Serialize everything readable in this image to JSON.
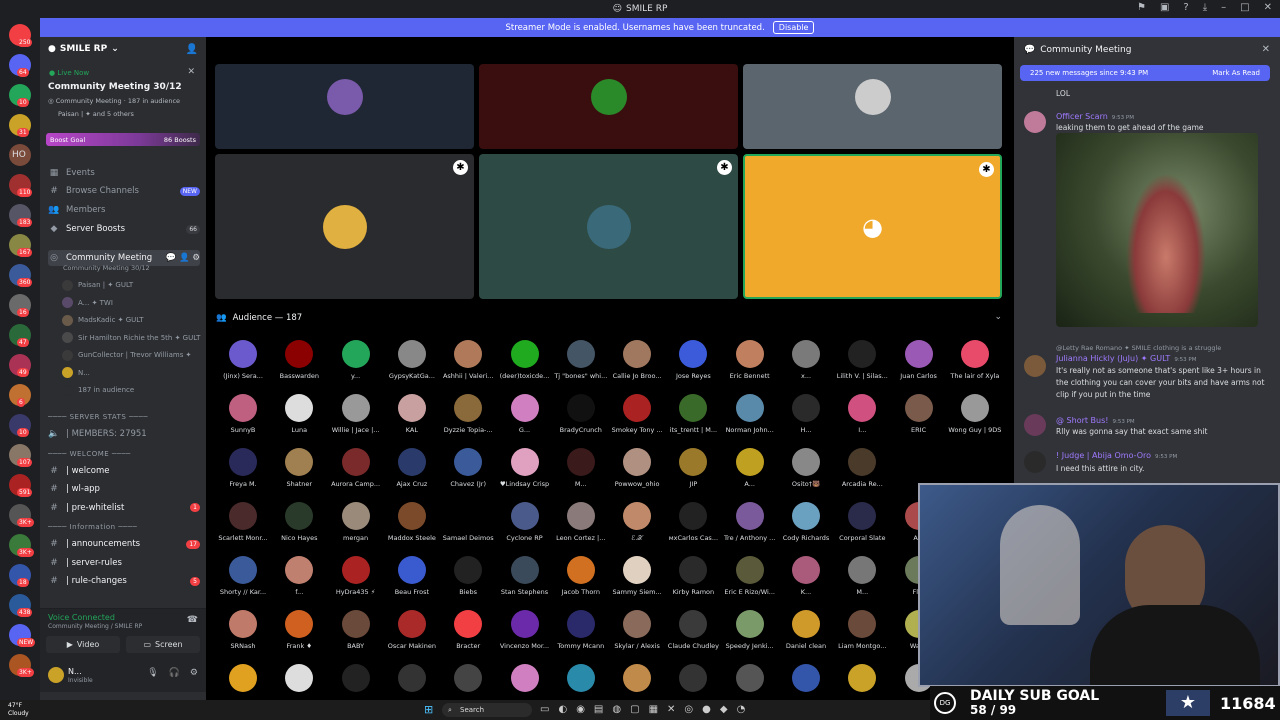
{
  "app": {
    "title": "SMILE RP",
    "titlebar_icons": [
      "flag-icon",
      "inbox-icon",
      "help-icon",
      "download-icon",
      "minimize-icon",
      "maximize-icon",
      "close-icon"
    ]
  },
  "banner": {
    "text": "Streamer Mode is enabled. Usernames have been truncated.",
    "button": "Disable"
  },
  "rail": {
    "badges": [
      "250",
      "64",
      "10",
      "31",
      "HO",
      "110",
      "183",
      "167",
      "360",
      "16",
      "47",
      "49",
      "6",
      "10",
      "107",
      "591",
      "3K+",
      "3K+",
      "18",
      "438",
      "NEW",
      "3K+"
    ]
  },
  "server": {
    "name": "SMILE RP",
    "live_now": "Live Now",
    "event_title": "Community Meeting 30/12",
    "event_channel": "Community Meeting",
    "event_audience": "187 in audience",
    "event_people": "Paisan | ✦ and 5 others",
    "boost_goal": "Boost Goal",
    "boost_count": "86 Boosts"
  },
  "channels": [
    {
      "icon": "▦",
      "label": "Events"
    },
    {
      "icon": "#",
      "label": "Browse Channels",
      "badge": "NEW"
    },
    {
      "icon": "👥",
      "label": "Members"
    },
    {
      "icon": "◆",
      "label": "Server Boosts",
      "badge": "66"
    }
  ],
  "stage_channel": {
    "name": "Community Meeting",
    "sub": "Community Meeting 30/12",
    "members": [
      "Paisan | ✦ GULT",
      "A... ✦ TWI",
      "MadsKadic ✦ GULT",
      "Sir Hamilton Richie the 5th ✦ GULT",
      "GunCollector | Trevor Williams ✦",
      "N...",
      "187 in audience"
    ]
  },
  "categories": [
    {
      "label": "──── SERVER STATS ────",
      "items": [
        {
          "label": "| MEMBERS: 27951"
        }
      ]
    },
    {
      "label": "──── WELCOME ────",
      "items": [
        {
          "label": "| welcome"
        },
        {
          "label": "| wl-app"
        },
        {
          "label": "| pre-whitelist",
          "badge": "1"
        }
      ]
    },
    {
      "label": "──── Information ────",
      "items": [
        {
          "label": "| announcements",
          "badge": "17"
        },
        {
          "label": "| server-rules"
        },
        {
          "label": "| rule-changes",
          "badge": "5"
        }
      ]
    }
  ],
  "voice": {
    "status": "Voice Connected",
    "channel": "Community Meeting / SMILE RP",
    "video": "Video",
    "screen": "Screen"
  },
  "user": {
    "name": "N...",
    "status": "Invisible"
  },
  "tile_colors": [
    "#1e2733",
    "#3a0e0e",
    "#5b656e",
    "#2a2b2e",
    "#2d4a44",
    "#f0a92a"
  ],
  "audience_title": "Audience — 187",
  "audience": [
    "(Jinx) Sera...",
    "Basswarden",
    "y...",
    "GypsyKatGa...",
    "Ashhii | Valeri...",
    "(deer)toxicde...",
    "Tj \"bones\" whi...",
    "Callie Jo Broo...",
    "Jose Reyes",
    "Eric Bennett",
    "x...",
    "Lilith V. | Silas...",
    "Juan Carlos",
    "The lair of Xyla",
    "SunnyB",
    "Luna",
    "Willie | Jace |...",
    "KAL",
    "Dyzzie Topia-...",
    "G...",
    "BradyCrunch",
    "Smokey Tony ...",
    "its_trentt | M...",
    "Norman John...",
    "H...",
    "I...",
    "ERIC",
    "Wong Guy | 9DS",
    "Freya M.",
    "Shatner",
    "Aurora Camp...",
    "Ajax Cruz",
    "Chavez (Jr)",
    "♥Lindsay Crisp",
    "M...",
    "Powwow_ohio",
    "JIP",
    "A...",
    "Osito†🐻",
    "Arcadia Re...",
    "",
    "",
    "Scarlett Monr...",
    "Nico Hayes",
    "mergan",
    "Maddox Steele",
    "Samael Deimos",
    "Cyclone RP",
    "Leon Cortez |...",
    "ℰ.𝒳",
    "мxCarlos Cas...",
    "Tre / Anthony ...",
    "Cody Richards",
    "Corporal Slate",
    "A...",
    "",
    "Shorty // Kar...",
    "f...",
    "HyDra435 ⚡",
    "Beau Frost",
    "Biebs",
    "Stan Stephens",
    "Jacob Thorn",
    "Sammy Siem...",
    "Kirby Ramon",
    "Eric E Rizo/Wi...",
    "K...",
    "M...",
    "Flat",
    "",
    "SRNash",
    "Frank ♦",
    "BABY",
    "Oscar Makinen",
    "Bracter",
    "Vincenzo Mor...",
    "Tommy Mcann",
    "Skylar / Alexis",
    "Claude Chudley",
    "Speedy Jenki...",
    "Daniel clean",
    "Liam Montgo...",
    "Wally",
    ""
  ],
  "audience_colors": [
    "#6a5acd",
    "#8b0000",
    "#23a55a",
    "#888888",
    "#b07a5a",
    "#1faa1f",
    "#445566",
    "#a07860",
    "#3b5bdb",
    "#c08060",
    "#7a7a7a",
    "#222222",
    "#9b59b6",
    "#e84a6a",
    "#c06080",
    "#dddddd",
    "#999999",
    "#c9a0a0",
    "#8a6a3a",
    "#d080c0",
    "#111111",
    "#aa2222",
    "#3a6a2a",
    "#5a8aaa",
    "#2a2a2a",
    "#d05080",
    "#7a5a4a",
    "#999999",
    "#2a2a5a",
    "#a08050",
    "#7a2a2a",
    "#2a3a6a",
    "#3a5a9a",
    "#e0a0c0",
    "#3a1a1a",
    "#b09080",
    "#9a7a2a",
    "#c0a020",
    "#888888",
    "#4a3a2a",
    "#2a3a3a",
    "#c0a080",
    "#4a2a2a",
    "#2a3a2a",
    "#9a8a7a",
    "#7a4a2a",
    "#000000",
    "#4a5a8a",
    "#8a7a7a",
    "#c08a6a",
    "#222222",
    "#7a5a9a",
    "#6aa0c0",
    "#2a2a4a",
    "#aa4a4a",
    "#000000",
    "#3a5a9a",
    "#c08070",
    "#aa2222",
    "#3a5ad0",
    "#222222",
    "#3a4a5a",
    "#d07020",
    "#e0d0c0",
    "#2a2a2a",
    "#5a5a3a",
    "#aa5a7a",
    "#777777",
    "#6a7a5a",
    "#000000",
    "#c07a6a",
    "#d06020",
    "#6a4a3a",
    "#aa2a2a",
    "#f23f43",
    "#6a2aaa",
    "#2a2a6a",
    "#8a6a5a",
    "#3a3a3a",
    "#7a9a6a",
    "#d09a2a",
    "#6a4a3a",
    "#b0b050",
    "#000000"
  ],
  "chat": {
    "title": "Community Meeting",
    "new_messages": "225 new messages since 9:43 PM",
    "mark_read": "Mark As Read",
    "messages": [
      {
        "name": "",
        "time": "",
        "text": "LOL",
        "color": "#dbdee1"
      },
      {
        "name": "Officer Scarn",
        "time": "9:53 PM",
        "text": "leaking them to get ahead of the game",
        "color": "#a07aff"
      },
      {
        "name": "Julianna Hickly (JuJu) ✦ GULT",
        "time": "9:53 PM",
        "text": "It's really not as someone that's spent like 3+ hours in the clothing you can cover your bits and have arms not clip if you put in the time",
        "color": "#a07aff",
        "reply": "@Letty Rae Romano ✦ SMILE clothing is a struggle"
      },
      {
        "name": "@ Short Bus!",
        "time": "9:53 PM",
        "text": "Rlly was gonna say that exact same shit",
        "color": "#a07aff"
      },
      {
        "name": "! Judge | Abija Omo-Oro",
        "time": "9:53 PM",
        "text": "I need this attire in city.",
        "color": "#a07aff"
      }
    ]
  },
  "subgoal": {
    "title": "DAILY SUB GOAL",
    "progress": "58 / 99",
    "count": "11684",
    "logo": "DG"
  },
  "taskbar": {
    "temp": "47°F",
    "weather": "Cloudy",
    "search": "Search"
  }
}
